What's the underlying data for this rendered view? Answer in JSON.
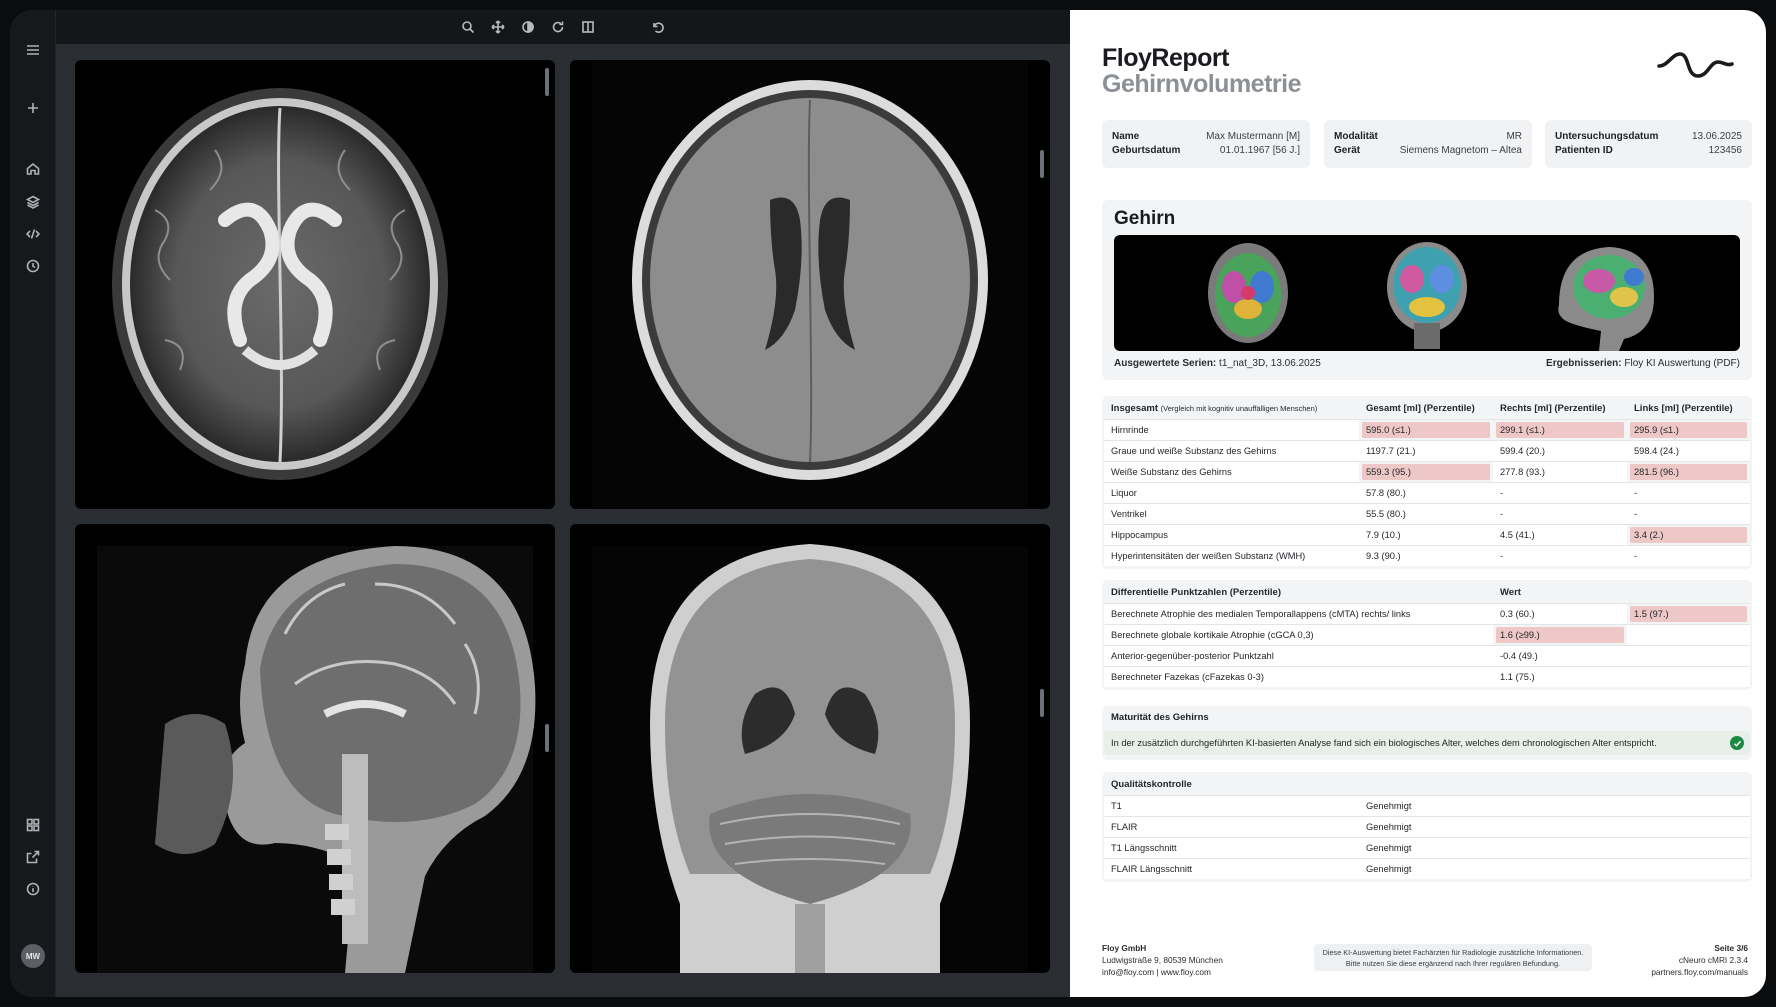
{
  "toolbar": {
    "icons": [
      "search-icon",
      "pan-icon",
      "contrast-icon",
      "rotate-icon",
      "split-icon",
      "undo-icon"
    ]
  },
  "sidebar": {
    "icons": [
      "menu-icon",
      "plus-icon",
      "home-icon",
      "layers-icon",
      "code-icon",
      "history-icon",
      "grid-icon",
      "external-link-icon",
      "info-icon"
    ],
    "avatar": "MW"
  },
  "report": {
    "brand_line1": "FloyReport",
    "brand_line2": "Gehirnvolumetrie",
    "patient": {
      "name_label": "Name",
      "name_value": "Max Mustermann [M]",
      "dob_label": "Geburtsdatum",
      "dob_value": "01.01.1967 [56 J.]"
    },
    "device": {
      "modality_label": "Modalität",
      "modality_value": "MR",
      "device_label": "Gerät",
      "device_value": "Siemens Magnetom – Altea"
    },
    "study": {
      "date_label": "Untersuchungsdatum",
      "date_value": "13.06.2025",
      "id_label": "Patienten ID",
      "id_value": "123456"
    },
    "gehirn": {
      "title": "Gehirn",
      "series_label": "Ausgewertete Serien:",
      "series_value": "t1_nat_3D, 13.06.2025",
      "results_label": "Ergebnisserien:",
      "results_value": "Floy KI Auswertung (PDF)"
    },
    "volumes": {
      "header": "Insgesamt",
      "header_note": "(Vergleich mit kognitiv unauffälligen Menschen)",
      "col1": "Gesamt [ml] (Perzentile)",
      "col2": "Rechts [ml] (Perzentile)",
      "col3": "Links [ml] (Perzentile)",
      "rows": [
        {
          "label": "Hirnrinde",
          "total": "595.0 (≤1.)",
          "right": "299.1 (≤1.)",
          "left": "295.9 (≤1.)"
        },
        {
          "label": "Graue und weiße Substanz des Gehirns",
          "total": "1197.7 (21.)",
          "right": "599.4 (20.)",
          "left": "598.4 (24.)"
        },
        {
          "label": "Weiße Substanz des Gehirns",
          "total": "559.3 (95.)",
          "right": "277.8 (93.)",
          "left": "281.5 (96.)"
        },
        {
          "label": "Liquor",
          "total": "57.8 (80.)",
          "right": "-",
          "left": "-"
        },
        {
          "label": "Ventrikel",
          "total": "55.5 (80.)",
          "right": "-",
          "left": "-"
        },
        {
          "label": "Hippocampus",
          "total": "7.9 (10.)",
          "right": "4.5 (41.)",
          "left": "3.4 (2.)"
        },
        {
          "label": "Hyperintensitäten der weißen Substanz (WMH)",
          "total": "9.3 (90.)",
          "right": "-",
          "left": "-"
        }
      ]
    },
    "scores": {
      "header": "Differentielle Punktzahlen (Perzentile)",
      "col": "Wert",
      "rows": [
        {
          "label": "Berechnete Atrophie des medialen Temporallappens (cMTA) rechts/ links",
          "value": "0.3 (60.)",
          "value2": "1.5 (97.)"
        },
        {
          "label": "Berechnete globale kortikale Atrophie (cGCA 0,3)",
          "value": "1.6 (≥99.)",
          "value2": ""
        },
        {
          "label": "Anterior-gegenüber-posterior Punktzahl",
          "value": "-0.4 (49.)",
          "value2": ""
        },
        {
          "label": "Berechneter Fazekas (cFazekas 0-3)",
          "value": "1.1 (75.)",
          "value2": ""
        }
      ]
    },
    "maturity": {
      "header": "Maturität des Gehirns",
      "text": "In der zusätzlich durchgeführten KI-basierten Analyse fand sich ein biologisches Alter, welches dem chronologischen Alter entspricht."
    },
    "quality": {
      "header": "Qualitätskontrolle",
      "rows": [
        {
          "label": "T1",
          "status": "Genehmigt"
        },
        {
          "label": "FLAIR",
          "status": "Genehmigt"
        },
        {
          "label": "T1 Längsschnitt",
          "status": "Genehmigt"
        },
        {
          "label": "FLAIR Längsschnitt",
          "status": "Genehmigt"
        }
      ]
    },
    "footer": {
      "company": "Floy GmbH",
      "address": "Ludwigstraße 9, 80539 München",
      "contact": "info@floy.com | www.floy.com",
      "disclaimer1": "Diese KI-Auswertung bietet Fachärzten für Radiologie zusätzliche Informationen.",
      "disclaimer2": "Bitte nutzen Sie diese ergänzend nach Ihrer regulären Befundung.",
      "page": "Seite 3/6",
      "version": "cNeuro cMRI 2.3.4",
      "manuals": "partners.floy.com/manuals"
    },
    "colors": {
      "flag": "#eec8c6",
      "ok": "#1d8a44",
      "panel": "#f3f4f5"
    }
  }
}
